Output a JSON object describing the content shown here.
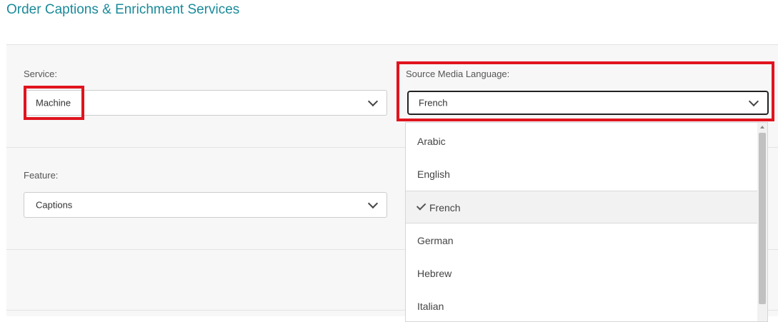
{
  "page_title": "Order Captions & Enrichment Services",
  "service": {
    "label": "Service:",
    "value": "Machine"
  },
  "source_language": {
    "label": "Source Media Language:",
    "value": "French",
    "options": [
      {
        "label": "Arabic"
      },
      {
        "label": "English"
      },
      {
        "label": "French",
        "selected": true
      },
      {
        "label": "German"
      },
      {
        "label": "Hebrew"
      },
      {
        "label": "Italian"
      }
    ]
  },
  "feature": {
    "label": "Feature:",
    "value": "Captions"
  },
  "colors": {
    "title": "#1a8a9a",
    "highlight": "#e0141e"
  }
}
